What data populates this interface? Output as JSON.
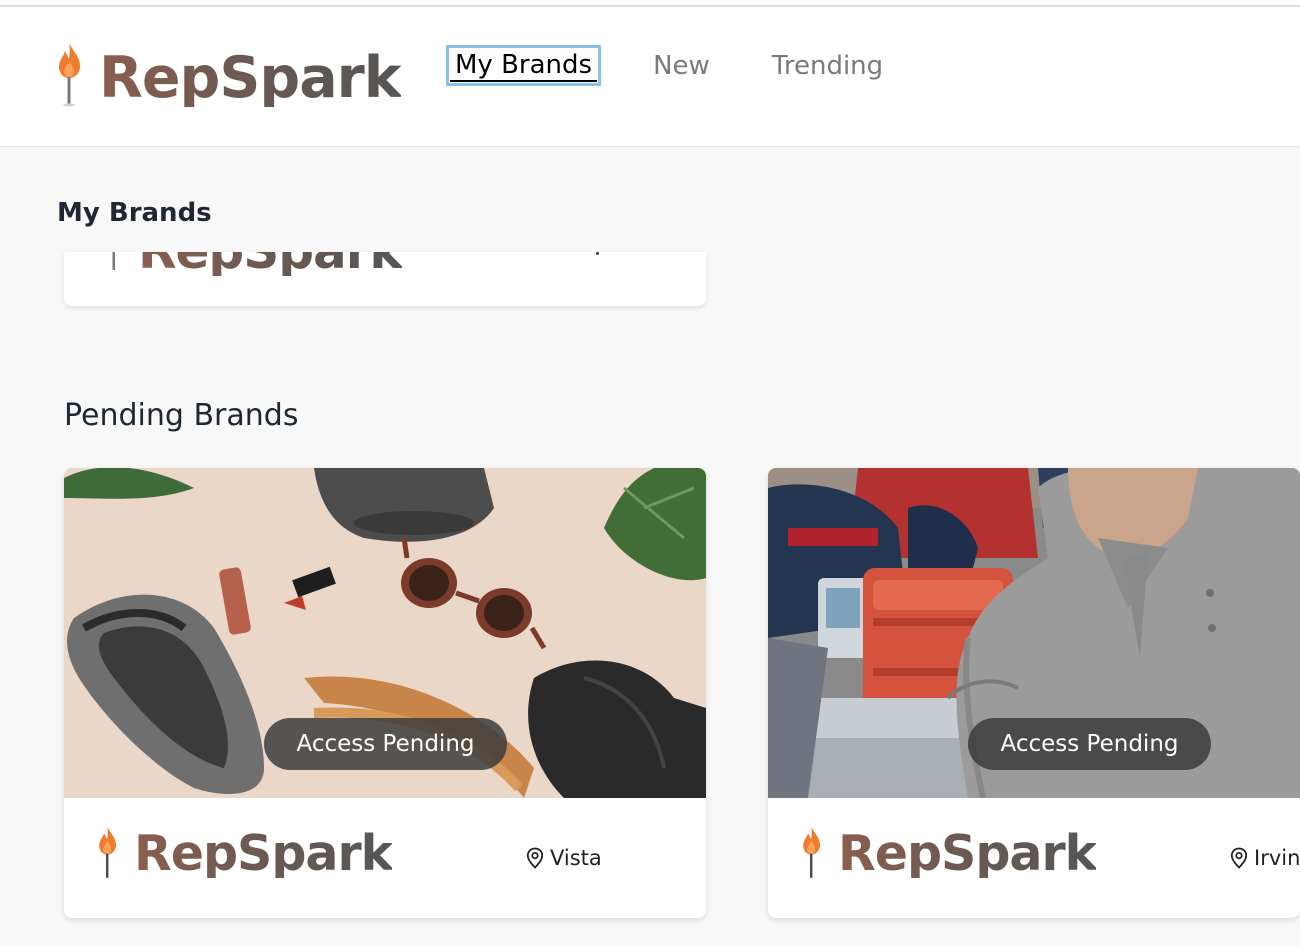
{
  "app": {
    "name": "RepSpark"
  },
  "nav": {
    "items": [
      {
        "label": "My Brands",
        "active": true
      },
      {
        "label": "New",
        "active": false
      },
      {
        "label": "Trending",
        "active": false
      }
    ]
  },
  "my_brands": {
    "title": "My Brands"
  },
  "pending_brands": {
    "title": "Pending Brands",
    "cards": [
      {
        "badge": "Access Pending",
        "logo_text": "RepSpark",
        "location": "Vista",
        "photo": "flat-lay-sneaker-sunglasses-bag"
      },
      {
        "badge": "Access Pending",
        "logo_text": "RepSpark",
        "location": "Irvine",
        "photo": "man-in-polo-with-medical-gear"
      }
    ]
  },
  "colors": {
    "accent_focus": "#88c1ea",
    "flame": "#f07a2e",
    "logo_text": "#6b5a54",
    "badge_bg": "#3c3c3c"
  },
  "icons": [
    "flame-icon",
    "location-pin-icon"
  ]
}
